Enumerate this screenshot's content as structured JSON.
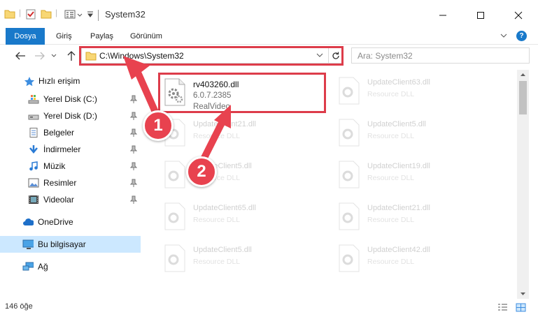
{
  "window": {
    "title": "System32",
    "controls": [
      "minimize-icon",
      "maximize-icon",
      "close-icon"
    ]
  },
  "ribbon": {
    "tabs": [
      {
        "label": "Dosya",
        "active": true
      },
      {
        "label": "Giriş"
      },
      {
        "label": "Paylaş"
      },
      {
        "label": "Görünüm"
      }
    ],
    "help": "?"
  },
  "navigation": {
    "address": "C:\\Windows\\System32",
    "search_placeholder": "Ara: System32"
  },
  "sidebar": {
    "quick_access": "Hızlı erişim",
    "items": [
      {
        "label": "Yerel Disk (C:)",
        "icon": "drive-c-icon",
        "pinned": true
      },
      {
        "label": "Yerel Disk (D:)",
        "icon": "drive-d-icon",
        "pinned": true
      },
      {
        "label": "Belgeler",
        "icon": "documents-icon",
        "pinned": true
      },
      {
        "label": "İndirmeler",
        "icon": "downloads-icon",
        "pinned": true
      },
      {
        "label": "Müzik",
        "icon": "music-icon",
        "pinned": true
      },
      {
        "label": "Resimler",
        "icon": "pictures-icon",
        "pinned": true
      },
      {
        "label": "Videolar",
        "icon": "videos-icon",
        "pinned": true
      }
    ],
    "onedrive": "OneDrive",
    "this_pc": "Bu bilgisayar",
    "network": "Ağ"
  },
  "files": {
    "main": {
      "name": "rv403260.dll",
      "version": "6.0.7.2385",
      "description": "RealVideo"
    },
    "faded": [
      {
        "name": "UpdateClient63.dll",
        "type": "Resource DLL"
      },
      {
        "name": "UpdateClient21.dll",
        "type": "Resource DLL"
      },
      {
        "name": "UpdateClient5.dll",
        "type": "Resource DLL"
      },
      {
        "name": "UpdateClient5.dll",
        "type": "Resource DLL"
      },
      {
        "name": "UpdateClient19.dll",
        "type": "Resource DLL"
      },
      {
        "name": "UpdateClient65.dll",
        "type": "Resource DLL"
      },
      {
        "name": "UpdateClient21.dll",
        "type": "Resource DLL"
      },
      {
        "name": "UpdateClient5.dll",
        "type": "Resource DLL"
      },
      {
        "name": "UpdateClient42.dll",
        "type": "Resource DLL"
      }
    ]
  },
  "annotations": {
    "step1": "1",
    "step2": "2",
    "highlight_color": "#dd3c4a",
    "bubble_color": "#e8424f"
  },
  "status": {
    "item_count": "146 öğe"
  },
  "colors": {
    "accent": "#1979ca",
    "selection": "#cce8ff"
  }
}
